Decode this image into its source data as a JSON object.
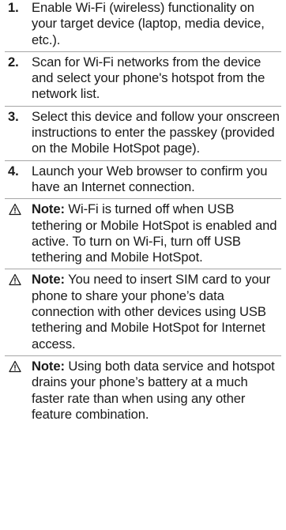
{
  "steps": [
    {
      "number": "1.",
      "text": "Enable Wi-Fi (wireless) functionality on your target device (laptop, media device, etc.)."
    },
    {
      "number": "2.",
      "text": "Scan for Wi-Fi networks from the device and select your phone's hotspot from the network list."
    },
    {
      "number": "3.",
      "text": "Select this device and follow your onscreen instructions to enter the passkey (provided on the Mobile HotSpot page)."
    },
    {
      "number": "4.",
      "text": "Launch your Web browser to confirm you have an Internet connection."
    }
  ],
  "notes": [
    {
      "icon": "warning-icon",
      "label": "Note:",
      "text": "Wi-Fi is turned off when USB tethering or Mobile HotSpot is enabled and active. To turn on Wi-Fi, turn off USB tethering and Mobile HotSpot."
    },
    {
      "icon": "warning-icon",
      "label": "Note:",
      "text": "You need to insert SIM card to your phone to share your phone’s data connection with other devices using USB tethering and Mobile HotSpot for Internet access."
    },
    {
      "icon": "warning-icon",
      "label": "Note:",
      "text": "Using both data service and hotspot drains your phone’s battery at a much faster rate than when using any other feature combination."
    }
  ]
}
